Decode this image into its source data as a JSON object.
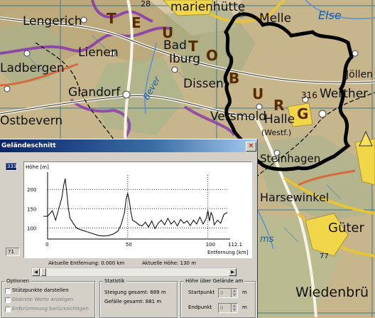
{
  "map": {
    "labels": {
      "lengerich": "Lengerich",
      "marienhuette": "marienhütte",
      "melle": "Melle",
      "else": "Else",
      "teuto_t": "T",
      "teuto_e": "E",
      "teuto_u": "U",
      "teuto_t2": "T",
      "teuto_o": "O",
      "teuto_b": "B",
      "teuto_u2": "U",
      "teuto_r": "R",
      "teuto_g": "G",
      "lienen": "Lienen",
      "bad": "Bad",
      "iburg": "Iburg",
      "ladbergen": "Ladbergen",
      "glandorf": "Glandorf",
      "bever": "Bever",
      "dissen": "Dissen",
      "joellen": "Jöllen",
      "werther": "Werther",
      "elev316": "316",
      "ostbevern": "Ostbevern",
      "versmold": "Versmold",
      "halle": "Halle",
      "westf": "(Westf.)",
      "steinhagen": "Steinhagen",
      "harsewinkel": "Harsewinkel",
      "gueter": "Güter",
      "elev77": "77",
      "wiedenbrue": "Wiedenbrü",
      "num28": "28",
      "ems": "ms"
    }
  },
  "dialog": {
    "title": "Geländeschnitt",
    "close_symbol": "✕",
    "max_value": "333",
    "min_value": "71",
    "chart_title": "Höhe [m]",
    "info": {
      "distance": "Aktuelle Entfernung: 0.000 km",
      "height": "Aktuelle Höhe: 130 m"
    },
    "options": {
      "title": "Optionen",
      "items": [
        "Stützpunkte darstellen",
        "Diskrete Werte anzeigen",
        "Erdkrümmung berücksichtigen"
      ]
    },
    "stats": {
      "title": "Statistik",
      "ascent": "Steigung gesamt: 889 m",
      "descent": "Gefälle gesamt: 881 m"
    },
    "height_above": {
      "title": "Höhe über Gelände am",
      "start_label": "Startpunkt",
      "end_label": "Endpunkt",
      "start_value": "0",
      "end_value": "0",
      "unit": "m"
    }
  },
  "chart_data": {
    "type": "line",
    "ylabel": "Höhe [m]",
    "xlabel": "Entfernung [km]",
    "xlim": [
      0,
      112.1
    ],
    "ylim": [
      71,
      230
    ],
    "x_ticks": [
      "0",
      "50",
      "100",
      "112.1"
    ],
    "y_ticks": [
      "200",
      "150",
      "100"
    ],
    "grid": true,
    "series": [
      {
        "color": "#000000",
        "x": [
          0,
          3,
          5,
          7,
          9,
          10,
          11,
          12,
          13,
          14,
          16,
          18,
          20,
          23,
          26,
          29,
          32,
          35,
          38,
          41,
          44,
          46,
          48,
          49,
          50,
          51,
          52,
          53,
          55,
          57,
          59,
          61,
          63,
          65,
          67,
          69,
          71,
          73,
          75,
          77,
          79,
          81,
          83,
          85,
          87,
          89,
          91,
          93,
          95,
          97,
          99,
          100,
          101,
          102,
          103,
          104,
          106,
          108,
          110,
          112.1
        ],
        "y": [
          130,
          145,
          120,
          150,
          180,
          210,
          228,
          190,
          150,
          125,
          112,
          100,
          96,
          92,
          88,
          84,
          80,
          79,
          80,
          84,
          92,
          110,
          140,
          175,
          190,
          170,
          140,
          120,
          115,
          108,
          105,
          115,
          102,
          118,
          98,
          112,
          120,
          108,
          125,
          110,
          118,
          105,
          122,
          112,
          118,
          106,
          120,
          110,
          128,
          110,
          125,
          145,
          118,
          140,
          130,
          108,
          120,
          112,
          135,
          140
        ]
      }
    ]
  }
}
